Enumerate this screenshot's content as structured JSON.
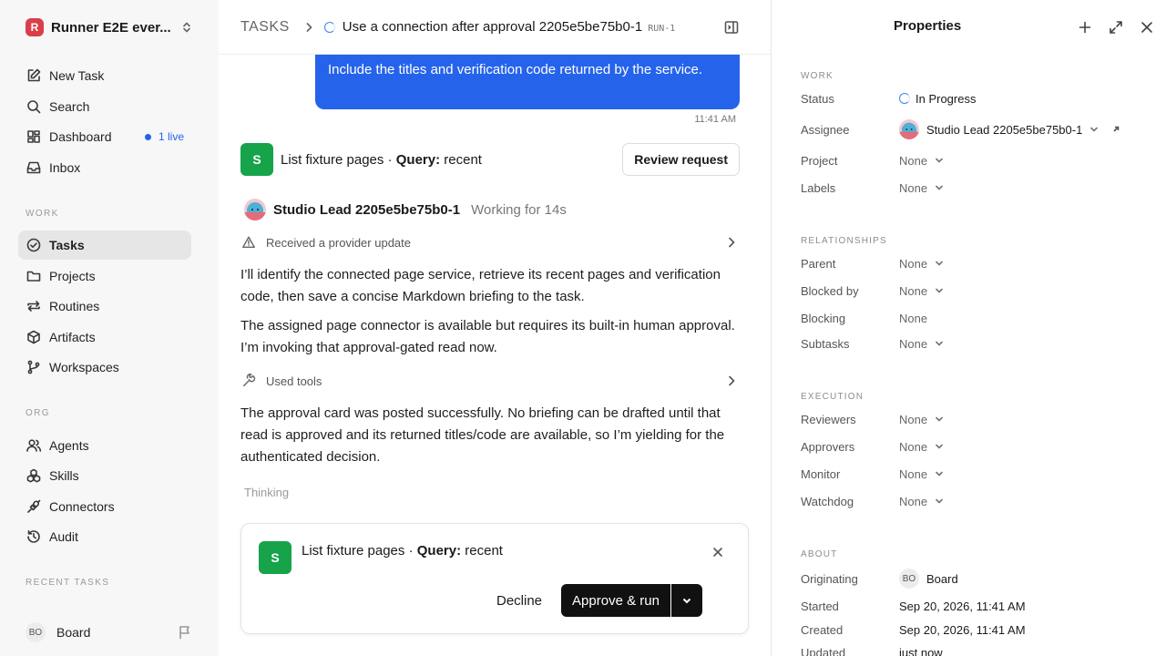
{
  "workspace": {
    "logo_letter": "R",
    "name": "Runner E2E ever..."
  },
  "sidebar": {
    "nav": [
      {
        "label": "New Task",
        "icon": "edit-icon"
      },
      {
        "label": "Search",
        "icon": "search-icon"
      },
      {
        "label": "Dashboard",
        "icon": "dashboard-icon",
        "badge": "1 live"
      },
      {
        "label": "Inbox",
        "icon": "inbox-icon"
      }
    ],
    "work_section": "WORK",
    "work": [
      {
        "label": "Tasks",
        "icon": "check-circle-icon",
        "active": true
      },
      {
        "label": "Projects",
        "icon": "folder-icon"
      },
      {
        "label": "Routines",
        "icon": "repeat-icon"
      },
      {
        "label": "Artifacts",
        "icon": "cube-icon"
      },
      {
        "label": "Workspaces",
        "icon": "branch-icon"
      }
    ],
    "org_section": "ORG",
    "org": [
      {
        "label": "Agents",
        "icon": "users-icon"
      },
      {
        "label": "Skills",
        "icon": "boxes-icon"
      },
      {
        "label": "Connectors",
        "icon": "plug-icon"
      },
      {
        "label": "Audit",
        "icon": "history-icon"
      }
    ],
    "recent_section": "RECENT TASKS",
    "user": {
      "initials": "BO",
      "name": "Board"
    }
  },
  "header": {
    "breadcrumb_root": "TASKS",
    "task_title": "Use a connection after approval 2205e5be75b0-1",
    "run_id": "RUN-1"
  },
  "conversation": {
    "user_message": "Include the titles and verification code returned by the service.",
    "user_message_time": "11:41 AM",
    "tool_request": {
      "badge": "S",
      "name": "List fixture pages",
      "sep": " · ",
      "param_key": "Query:",
      "param_value": " recent",
      "review_label": "Review request"
    },
    "agent": {
      "name": "Studio Lead 2205e5be75b0-1",
      "status": "Working for 14s"
    },
    "event_provider": "Received a provider update",
    "para1": "I’ll identify the connected page service, retrieve its recent pages and verification code, then save a concise Markdown briefing to the task.",
    "para2": "The assigned page connector is available but requires its built-in human approval. I’m invoking that approval-gated read now.",
    "event_tools": "Used tools",
    "para3": "The approval card was posted successfully. No briefing can be drafted until that read is approved and its returned titles/code are available, so I’m yielding for the authenticated decision.",
    "thinking": "Thinking"
  },
  "approval": {
    "badge": "S",
    "name": "List fixture pages",
    "sep": " · ",
    "param_key": "Query:",
    "param_value": " recent",
    "decline_label": "Decline",
    "approve_label": "Approve & run"
  },
  "properties": {
    "title": "Properties",
    "work_section": "WORK",
    "status_label": "Status",
    "status_value": "In Progress",
    "assignee_label": "Assignee",
    "assignee_value": "Studio Lead 2205e5be75b0-1",
    "project_label": "Project",
    "project_value": "None",
    "labels_label": "Labels",
    "labels_value": "None",
    "relationships_section": "RELATIONSHIPS",
    "parent_label": "Parent",
    "parent_value": "None",
    "blocked_by_label": "Blocked by",
    "blocked_by_value": "None",
    "blocking_label": "Blocking",
    "blocking_value": "None",
    "subtasks_label": "Subtasks",
    "subtasks_value": "None",
    "execution_section": "EXECUTION",
    "reviewers_label": "Reviewers",
    "reviewers_value": "None",
    "approvers_label": "Approvers",
    "approvers_value": "None",
    "monitor_label": "Monitor",
    "monitor_value": "None",
    "watchdog_label": "Watchdog",
    "watchdog_value": "None",
    "about_section": "ABOUT",
    "originating_label": "Originating",
    "originating_initials": "BO",
    "originating_value": "Board",
    "started_label": "Started",
    "started_value": "Sep 20, 2026, 11:41 AM",
    "created_label": "Created",
    "created_value": "Sep 20, 2026, 11:41 AM",
    "updated_label": "Updated",
    "updated_value": "just now"
  },
  "colors": {
    "accent": "#2563eb",
    "tool_badge": "#16a34a",
    "brand": "#d93f4a"
  }
}
